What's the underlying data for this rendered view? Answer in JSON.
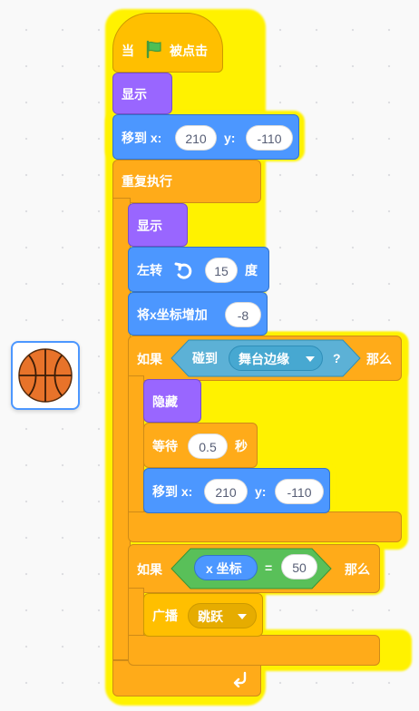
{
  "hat": {
    "when": "当",
    "flag_icon": "green-flag-icon",
    "clicked": "被点击"
  },
  "show1": {
    "label": "显示"
  },
  "goto1": {
    "label": "移到 x:",
    "x": "210",
    "y_label": "y:",
    "y": "-110"
  },
  "forever": {
    "label": "重复执行",
    "loop_icon": "loop-arrow-icon"
  },
  "show2": {
    "label": "显示"
  },
  "turn": {
    "label": "左转",
    "icon": "rotate-left-icon",
    "value": "15",
    "unit": "度"
  },
  "changex": {
    "label": "将x坐标增加",
    "value": "-8"
  },
  "if1": {
    "if_label": "如果",
    "then_label": "那么",
    "touching": "碰到",
    "target": "舞台边缘",
    "question": "?"
  },
  "hide": {
    "label": "隐藏"
  },
  "wait": {
    "label": "等待",
    "value": "0.5",
    "unit": "秒"
  },
  "goto2": {
    "label": "移到 x:",
    "x": "210",
    "y_label": "y:",
    "y": "-110"
  },
  "if2": {
    "if_label": "如果",
    "then_label": "那么",
    "xpos": "x 坐标",
    "equals": "=",
    "value": "50"
  },
  "broadcast": {
    "label": "广播",
    "message": "跳跃"
  },
  "sprite": {
    "icon": "basketball-icon"
  },
  "colors": {
    "events": "#ffbf00",
    "looks": "#9966ff",
    "motion": "#4c97ff",
    "control": "#ffab19",
    "sensing": "#5cb1d6",
    "operator": "#59c059",
    "highlight": "#fff200"
  }
}
